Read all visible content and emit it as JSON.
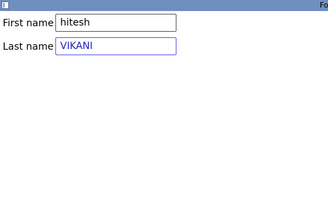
{
  "window": {
    "title": "Fo"
  },
  "form": {
    "first_name": {
      "label": "First name :",
      "value": "hitesh"
    },
    "last_name": {
      "label": "Last name :",
      "value": "VIKANI"
    }
  },
  "colors": {
    "titlebar": "#6f8fc0",
    "focused_field_border": "#5b5be0",
    "focused_field_text": "#2020b8"
  },
  "icons": {
    "app": "app-window-icon"
  }
}
